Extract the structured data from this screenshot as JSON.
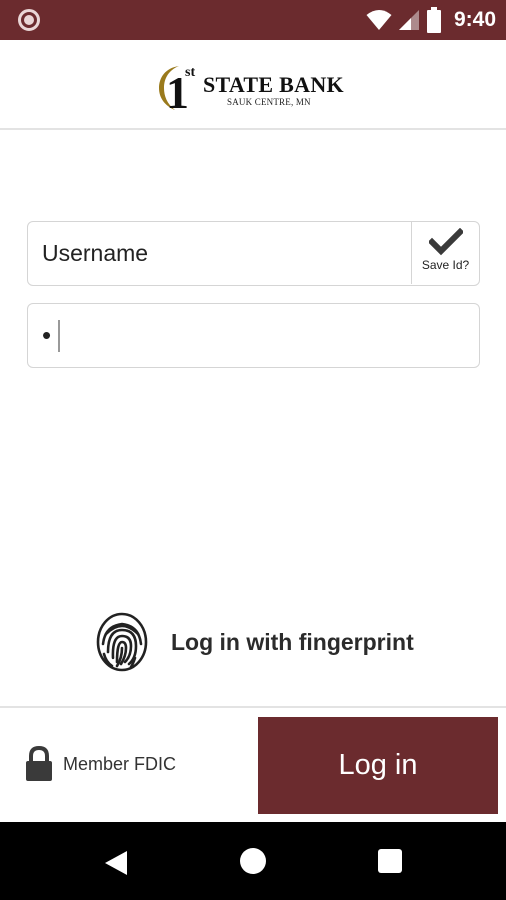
{
  "status_bar": {
    "time": "9:40",
    "left_icon": "circle-notification-icon",
    "icons": [
      "wifi-icon",
      "cell-signal-icon",
      "battery-icon"
    ],
    "background": "#6b2b2e"
  },
  "header": {
    "logo": {
      "superscript": "st",
      "numeral": "1",
      "name": "STATE BANK",
      "location": "SAUK CENTRE, MN"
    }
  },
  "login_form": {
    "username": {
      "placeholder": "Username",
      "value": ""
    },
    "save_id": {
      "label": "Save Id?",
      "icon": "checkmark-icon"
    },
    "password": {
      "value": "•"
    }
  },
  "fingerprint": {
    "label": "Log in with fingerprint",
    "icon": "fingerprint-icon"
  },
  "footer": {
    "fdic_label": "Member FDIC",
    "fdic_icon": "lock-icon",
    "login_button": "Log in",
    "accent": "#6b2b2e"
  },
  "nav_bar": {
    "buttons": [
      "back-icon",
      "home-icon",
      "recents-icon"
    ]
  }
}
